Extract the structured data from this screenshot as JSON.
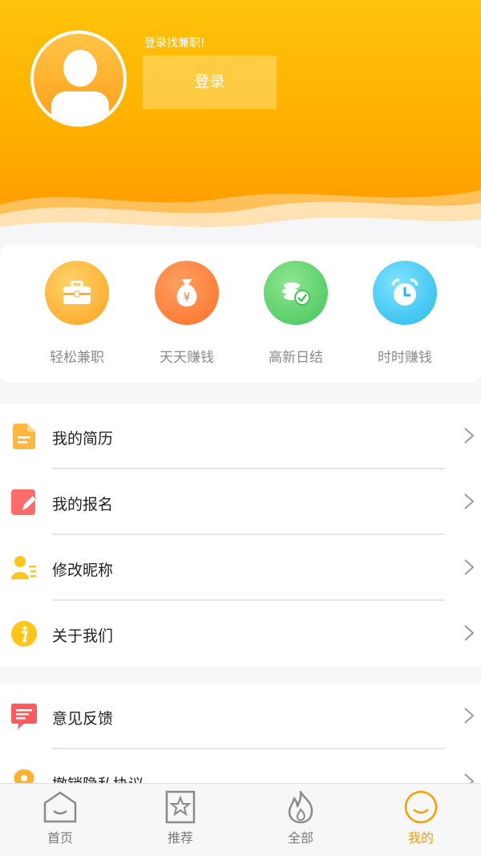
{
  "header": {
    "login_hint": "登录找兼职!",
    "login_button": "登录"
  },
  "quick_actions": [
    {
      "label": "轻松兼职",
      "icon": "briefcase-icon",
      "color": "#ffb02e"
    },
    {
      "label": "天天赚钱",
      "icon": "money-bag-icon",
      "color": "#ff7a2f"
    },
    {
      "label": "高新日结",
      "icon": "coins-icon",
      "color": "#4cc95a"
    },
    {
      "label": "时时赚钱",
      "icon": "alarm-clock-icon",
      "color": "#33c3f0"
    }
  ],
  "menu_group1": [
    {
      "label": "我的简历",
      "icon": "resume-icon",
      "color": "#ffb740"
    },
    {
      "label": "我的报名",
      "icon": "signup-icon",
      "color": "#ff6b6b"
    },
    {
      "label": "修改昵称",
      "icon": "user-edit-icon",
      "color": "#ffc61a"
    },
    {
      "label": "关于我们",
      "icon": "info-icon",
      "color": "#ffc61a"
    }
  ],
  "menu_group2": [
    {
      "label": "意见反馈",
      "icon": "feedback-icon",
      "color": "#ff5a5a"
    },
    {
      "label": "撤销隐私协议",
      "icon": "location-pin-icon",
      "color": "#ffb02e"
    }
  ],
  "tabbar": [
    {
      "label": "首页",
      "icon": "home-icon",
      "active": false
    },
    {
      "label": "推荐",
      "icon": "star-bookmark-icon",
      "active": false
    },
    {
      "label": "全部",
      "icon": "flame-icon",
      "active": false
    },
    {
      "label": "我的",
      "icon": "smile-icon",
      "active": true
    }
  ],
  "colors": {
    "accent": "#f5a000",
    "header_top": "#ffc20a",
    "header_bottom": "#ff9a00"
  }
}
